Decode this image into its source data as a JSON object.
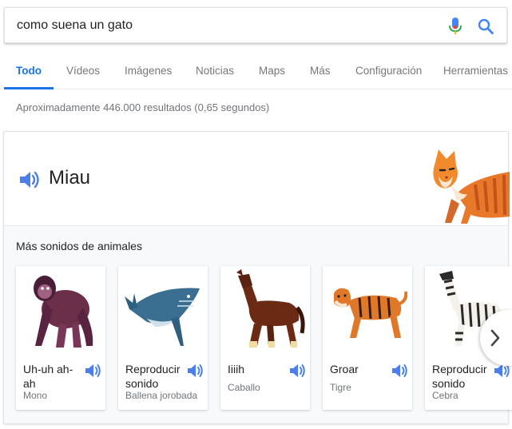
{
  "search": {
    "query": "como suena un gato"
  },
  "tabs": [
    {
      "label": "Todo"
    },
    {
      "label": "Vídeos"
    },
    {
      "label": "Imágenes"
    },
    {
      "label": "Noticias"
    },
    {
      "label": "Maps"
    },
    {
      "label": "Más"
    },
    {
      "label": "Configuración"
    },
    {
      "label": "Herramientas"
    }
  ],
  "stats": "Aproximadamente 446.000 resultados (0,65 segundos)",
  "card": {
    "sound_word": "Miau",
    "more_heading": "Más sonidos de animales",
    "animals": [
      {
        "sound": "Uh-uh ah-ah",
        "name": "Mono"
      },
      {
        "sound": "Reproducir sonido",
        "name": "Ballena jorobada"
      },
      {
        "sound": "Iiiih",
        "name": "Caballo"
      },
      {
        "sound": "Groar",
        "name": "Tigre"
      },
      {
        "sound": "Reproducir sonido",
        "name": "Cebra"
      }
    ]
  },
  "colors": {
    "accent": "#1a73e8",
    "speaker": "#4a80e8"
  },
  "icons": [
    "microphone-icon",
    "search-icon",
    "speaker-icon",
    "chevron-right-icon"
  ]
}
